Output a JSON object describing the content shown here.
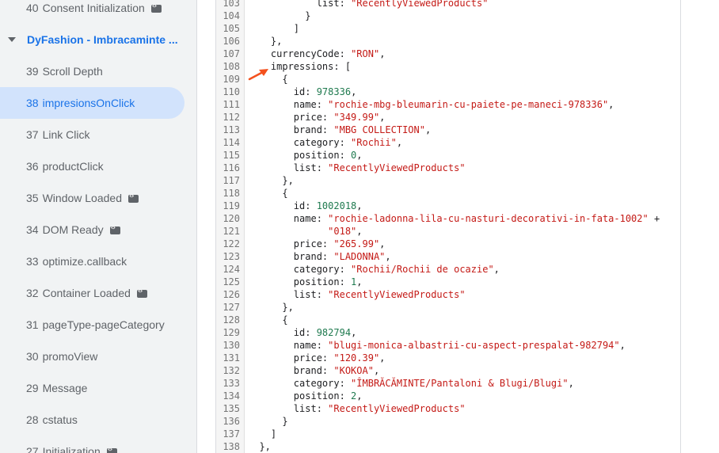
{
  "sidebar": {
    "items": [
      {
        "num": "40",
        "label": "Consent Initialization",
        "icon": true,
        "selected": false,
        "parent": false
      },
      {
        "num": "",
        "label": "DyFashion - Imbracaminte ...",
        "icon": false,
        "selected": false,
        "parent": true
      },
      {
        "num": "39",
        "label": "Scroll Depth",
        "icon": false,
        "selected": false,
        "parent": false
      },
      {
        "num": "38",
        "label": "impresionsOnClick",
        "icon": false,
        "selected": true,
        "parent": false
      },
      {
        "num": "37",
        "label": "Link Click",
        "icon": false,
        "selected": false,
        "parent": false
      },
      {
        "num": "36",
        "label": "productClick",
        "icon": false,
        "selected": false,
        "parent": false
      },
      {
        "num": "35",
        "label": "Window Loaded",
        "icon": true,
        "selected": false,
        "parent": false
      },
      {
        "num": "34",
        "label": "DOM Ready",
        "icon": true,
        "selected": false,
        "parent": false
      },
      {
        "num": "33",
        "label": "optimize.callback",
        "icon": false,
        "selected": false,
        "parent": false
      },
      {
        "num": "32",
        "label": "Container Loaded",
        "icon": true,
        "selected": false,
        "parent": false
      },
      {
        "num": "31",
        "label": "pageType-pageCategory",
        "icon": false,
        "selected": false,
        "parent": false
      },
      {
        "num": "30",
        "label": "promoView",
        "icon": false,
        "selected": false,
        "parent": false
      },
      {
        "num": "29",
        "label": "Message",
        "icon": false,
        "selected": false,
        "parent": false
      },
      {
        "num": "28",
        "label": "cstatus",
        "icon": false,
        "selected": false,
        "parent": false
      },
      {
        "num": "27",
        "label": "Initialization",
        "icon": true,
        "selected": false,
        "parent": false
      }
    ]
  },
  "code": {
    "lines": [
      {
        "n": "103",
        "indent": 12,
        "parts": [
          [
            "k",
            "list: "
          ],
          [
            "s",
            "\"RecentlyViewedProducts\""
          ]
        ]
      },
      {
        "n": "104",
        "indent": 10,
        "parts": [
          [
            "k",
            "}"
          ]
        ]
      },
      {
        "n": "105",
        "indent": 8,
        "parts": [
          [
            "k",
            "]"
          ]
        ]
      },
      {
        "n": "106",
        "indent": 4,
        "parts": [
          [
            "k",
            "},"
          ]
        ]
      },
      {
        "n": "107",
        "indent": 4,
        "parts": [
          [
            "k",
            "currencyCode: "
          ],
          [
            "s",
            "\"RON\""
          ],
          [
            "k",
            ","
          ]
        ]
      },
      {
        "n": "108",
        "indent": 4,
        "parts": [
          [
            "k",
            "impressions: ["
          ]
        ]
      },
      {
        "n": "109",
        "indent": 6,
        "parts": [
          [
            "k",
            "{"
          ]
        ]
      },
      {
        "n": "110",
        "indent": 8,
        "parts": [
          [
            "k",
            "id: "
          ],
          [
            "n",
            "978336"
          ],
          [
            "k",
            ","
          ]
        ]
      },
      {
        "n": "111",
        "indent": 8,
        "parts": [
          [
            "k",
            "name: "
          ],
          [
            "s",
            "\"rochie-mbg-bleumarin-cu-paiete-pe-maneci-978336\""
          ],
          [
            "k",
            ","
          ]
        ]
      },
      {
        "n": "112",
        "indent": 8,
        "parts": [
          [
            "k",
            "price: "
          ],
          [
            "s",
            "\"349.99\""
          ],
          [
            "k",
            ","
          ]
        ]
      },
      {
        "n": "113",
        "indent": 8,
        "parts": [
          [
            "k",
            "brand: "
          ],
          [
            "s",
            "\"MBG COLLECTION\""
          ],
          [
            "k",
            ","
          ]
        ]
      },
      {
        "n": "114",
        "indent": 8,
        "parts": [
          [
            "k",
            "category: "
          ],
          [
            "s",
            "\"Rochii\""
          ],
          [
            "k",
            ","
          ]
        ]
      },
      {
        "n": "115",
        "indent": 8,
        "parts": [
          [
            "k",
            "position: "
          ],
          [
            "n",
            "0"
          ],
          [
            "k",
            ","
          ]
        ]
      },
      {
        "n": "116",
        "indent": 8,
        "parts": [
          [
            "k",
            "list: "
          ],
          [
            "s",
            "\"RecentlyViewedProducts\""
          ]
        ]
      },
      {
        "n": "117",
        "indent": 6,
        "parts": [
          [
            "k",
            "},"
          ]
        ]
      },
      {
        "n": "118",
        "indent": 6,
        "parts": [
          [
            "k",
            "{"
          ]
        ]
      },
      {
        "n": "119",
        "indent": 8,
        "parts": [
          [
            "k",
            "id: "
          ],
          [
            "n",
            "1002018"
          ],
          [
            "k",
            ","
          ]
        ]
      },
      {
        "n": "120",
        "indent": 8,
        "parts": [
          [
            "k",
            "name: "
          ],
          [
            "s",
            "\"rochie-ladonna-lila-cu-nasturi-decorativi-in-fata-1002\""
          ],
          [
            "k",
            " +"
          ]
        ]
      },
      {
        "n": "121",
        "indent": 14,
        "parts": [
          [
            "s",
            "\"018\""
          ],
          [
            "k",
            ","
          ]
        ]
      },
      {
        "n": "122",
        "indent": 8,
        "parts": [
          [
            "k",
            "price: "
          ],
          [
            "s",
            "\"265.99\""
          ],
          [
            "k",
            ","
          ]
        ]
      },
      {
        "n": "123",
        "indent": 8,
        "parts": [
          [
            "k",
            "brand: "
          ],
          [
            "s",
            "\"LADONNA\""
          ],
          [
            "k",
            ","
          ]
        ]
      },
      {
        "n": "124",
        "indent": 8,
        "parts": [
          [
            "k",
            "category: "
          ],
          [
            "s",
            "\"Rochii/Rochii de ocazie\""
          ],
          [
            "k",
            ","
          ]
        ]
      },
      {
        "n": "125",
        "indent": 8,
        "parts": [
          [
            "k",
            "position: "
          ],
          [
            "n",
            "1"
          ],
          [
            "k",
            ","
          ]
        ]
      },
      {
        "n": "126",
        "indent": 8,
        "parts": [
          [
            "k",
            "list: "
          ],
          [
            "s",
            "\"RecentlyViewedProducts\""
          ]
        ]
      },
      {
        "n": "127",
        "indent": 6,
        "parts": [
          [
            "k",
            "},"
          ]
        ]
      },
      {
        "n": "128",
        "indent": 6,
        "parts": [
          [
            "k",
            "{"
          ]
        ]
      },
      {
        "n": "129",
        "indent": 8,
        "parts": [
          [
            "k",
            "id: "
          ],
          [
            "n",
            "982794"
          ],
          [
            "k",
            ","
          ]
        ]
      },
      {
        "n": "130",
        "indent": 8,
        "parts": [
          [
            "k",
            "name: "
          ],
          [
            "s",
            "\"blugi-monica-albastrii-cu-aspect-prespalat-982794\""
          ],
          [
            "k",
            ","
          ]
        ]
      },
      {
        "n": "131",
        "indent": 8,
        "parts": [
          [
            "k",
            "price: "
          ],
          [
            "s",
            "\"120.39\""
          ],
          [
            "k",
            ","
          ]
        ]
      },
      {
        "n": "132",
        "indent": 8,
        "parts": [
          [
            "k",
            "brand: "
          ],
          [
            "s",
            "\"KOKOA\""
          ],
          [
            "k",
            ","
          ]
        ]
      },
      {
        "n": "133",
        "indent": 8,
        "parts": [
          [
            "k",
            "category: "
          ],
          [
            "s",
            "\"ÎMBRĂCĂMINTE/Pantaloni & Blugi/Blugi\""
          ],
          [
            "k",
            ","
          ]
        ]
      },
      {
        "n": "134",
        "indent": 8,
        "parts": [
          [
            "k",
            "position: "
          ],
          [
            "n",
            "2"
          ],
          [
            "k",
            ","
          ]
        ]
      },
      {
        "n": "135",
        "indent": 8,
        "parts": [
          [
            "k",
            "list: "
          ],
          [
            "s",
            "\"RecentlyViewedProducts\""
          ]
        ]
      },
      {
        "n": "136",
        "indent": 6,
        "parts": [
          [
            "k",
            "}"
          ]
        ]
      },
      {
        "n": "137",
        "indent": 4,
        "parts": [
          [
            "k",
            "]"
          ]
        ]
      },
      {
        "n": "138",
        "indent": 2,
        "parts": [
          [
            "k",
            "},"
          ]
        ]
      }
    ]
  },
  "annotation": {
    "arrow_color": "#f4511e"
  },
  "colors": {
    "accent": "#1a73e8",
    "string": "#c41a16",
    "number": "#1f7a4f"
  }
}
